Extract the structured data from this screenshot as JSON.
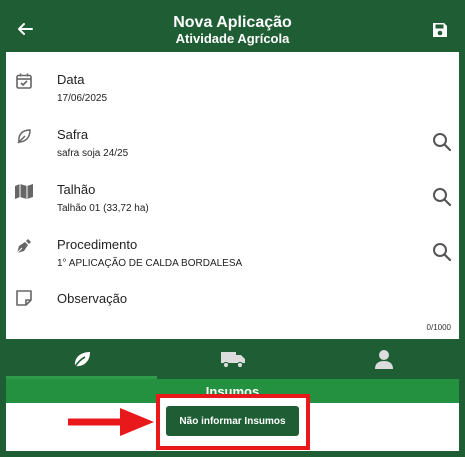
{
  "header": {
    "title": "Nova Aplicação",
    "subtitle": "Atividade Agrícola",
    "back_icon": "arrow-left-icon",
    "save_icon": "floppy-disk-icon"
  },
  "fields": [
    {
      "label": "Data",
      "value": "17/06/2025",
      "icon": "calendar-check-icon"
    },
    {
      "label": "Safra",
      "value": "safra soja 24/25",
      "icon": "leaf-icon"
    },
    {
      "label": "Talhão",
      "value": "Talhão 01 (33,72 ha)",
      "icon": "map-icon"
    },
    {
      "label": "Procedimento",
      "value": "1° APLICAÇÃO DE CALDA BORDALESA",
      "icon": "pen-nib-icon"
    }
  ],
  "observacao": {
    "label": "Observação",
    "counter": "0/1000",
    "icon": "note-icon"
  },
  "tabs": [
    {
      "icon": "leaf-tab-icon",
      "selected": true
    },
    {
      "icon": "truck-icon",
      "selected": false
    },
    {
      "icon": "person-icon",
      "selected": false
    }
  ],
  "section": {
    "title": "Insumos"
  },
  "actions": {
    "no_insumos_label": "Não informar Insumos"
  },
  "colors": {
    "primary": "#1f5e34",
    "section": "#249140",
    "highlight": "#e8181b"
  }
}
